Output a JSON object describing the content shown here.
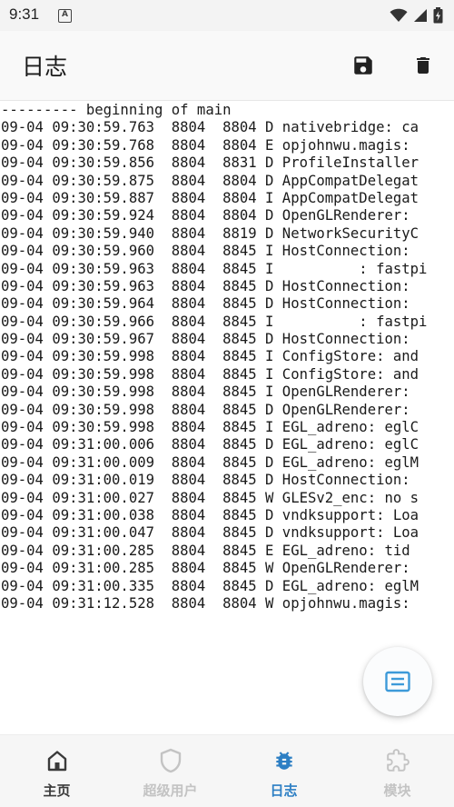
{
  "status_bar": {
    "time": "9:31",
    "app_icon_letter": "A"
  },
  "app_bar": {
    "title": "日志",
    "save_icon": "save-icon",
    "delete_icon": "delete-icon"
  },
  "log": {
    "lines": [
      "--------- beginning of main",
      "09-04 09:30:59.763  8804  8804 D nativebridge: ca",
      "09-04 09:30:59.768  8804  8804 E opjohnwu.magis:",
      "09-04 09:30:59.856  8804  8831 D ProfileInstaller",
      "09-04 09:30:59.875  8804  8804 D AppCompatDelegat",
      "09-04 09:30:59.887  8804  8804 I AppCompatDelegat",
      "09-04 09:30:59.924  8804  8804 D OpenGLRenderer:",
      "09-04 09:30:59.940  8804  8819 D NetworkSecurityC",
      "09-04 09:30:59.960  8804  8845 I HostConnection:",
      "09-04 09:30:59.963  8804  8845 I          : fastpi",
      "09-04 09:30:59.963  8804  8845 D HostConnection:",
      "09-04 09:30:59.964  8804  8845 D HostConnection:",
      "09-04 09:30:59.966  8804  8845 I          : fastpi",
      "09-04 09:30:59.967  8804  8845 D HostConnection:",
      "09-04 09:30:59.998  8804  8845 I ConfigStore: and",
      "09-04 09:30:59.998  8804  8845 I ConfigStore: and",
      "09-04 09:30:59.998  8804  8845 I OpenGLRenderer:",
      "09-04 09:30:59.998  8804  8845 D OpenGLRenderer:",
      "09-04 09:30:59.998  8804  8845 I EGL_adreno: eglC",
      "09-04 09:31:00.006  8804  8845 D EGL_adreno: eglC",
      "09-04 09:31:00.009  8804  8845 D EGL_adreno: eglM",
      "09-04 09:31:00.019  8804  8845 D HostConnection:",
      "09-04 09:31:00.027  8804  8845 W GLESv2_enc: no s",
      "09-04 09:31:00.038  8804  8845 D vndksupport: Loa",
      "09-04 09:31:00.047  8804  8845 D vndksupport: Loa",
      "09-04 09:31:00.285  8804  8845 E EGL_adreno: tid",
      "09-04 09:31:00.285  8804  8845 W OpenGLRenderer:",
      "09-04 09:31:00.335  8804  8845 D EGL_adreno: eglM",
      "09-04 09:31:12.528  8804  8804 W opjohnwu.magis: "
    ]
  },
  "fab": {
    "icon": "document-list-icon"
  },
  "bottom_nav": {
    "items": [
      {
        "label": "主页",
        "icon": "home-icon",
        "active": false,
        "color": "#3a3a3a"
      },
      {
        "label": "超级用户",
        "icon": "shield-icon",
        "active": false,
        "color": "#c3c3c3"
      },
      {
        "label": "日志",
        "icon": "bug-icon",
        "active": true,
        "color": "#2d7fc4"
      },
      {
        "label": "模块",
        "icon": "puzzle-icon",
        "active": false,
        "color": "#c3c3c3"
      }
    ]
  },
  "colors": {
    "accent": "#2d7fc4",
    "fab_icon": "#3d9ad9",
    "inactive": "#c3c3c3"
  }
}
